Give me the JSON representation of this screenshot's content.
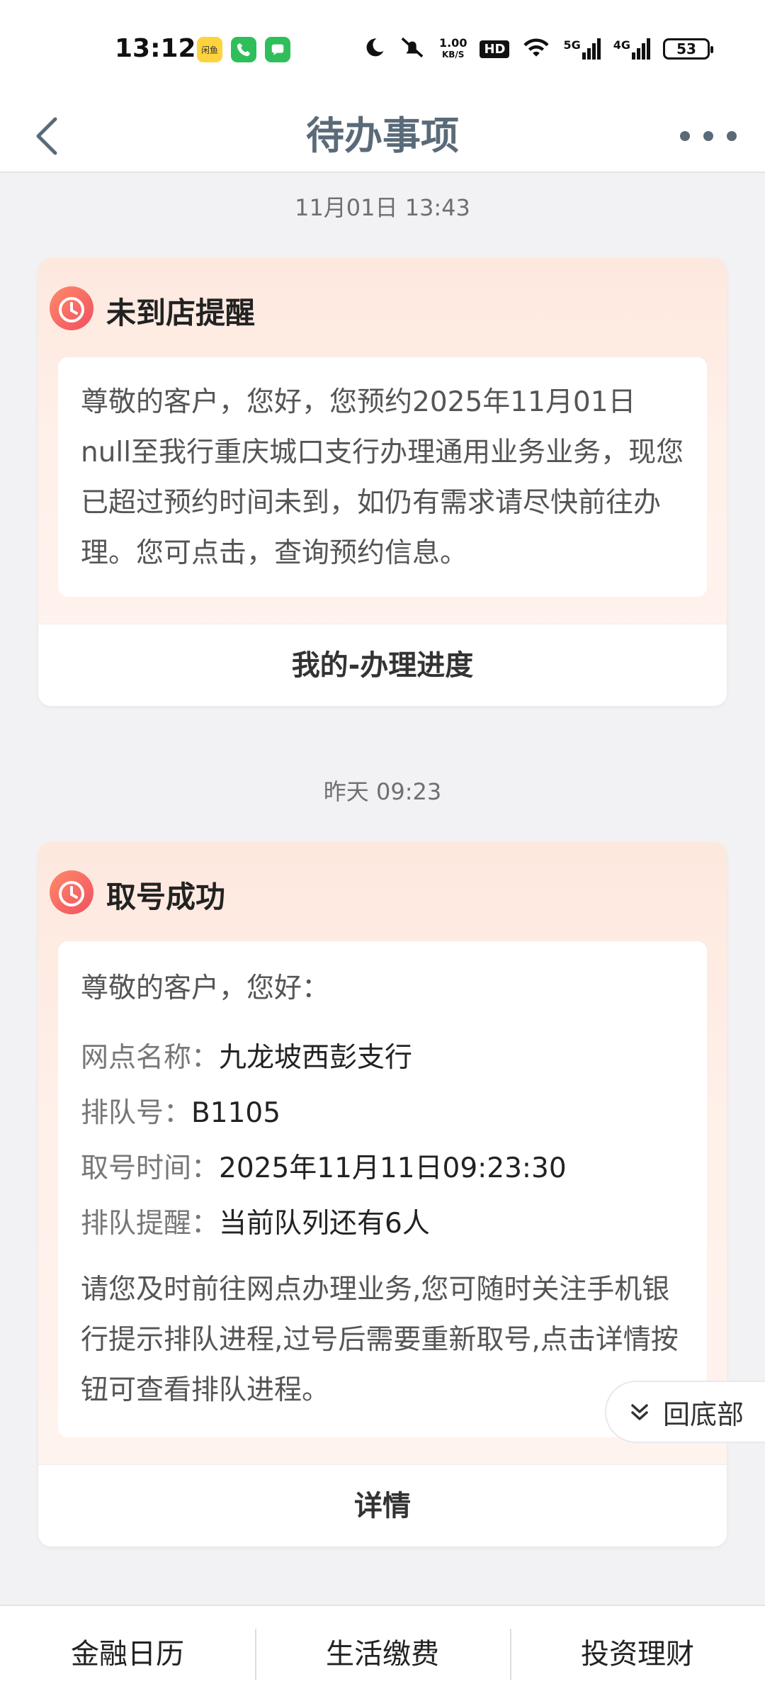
{
  "status_bar": {
    "time": "13:12",
    "network_speed_value": "1.00",
    "network_speed_unit": "KB/S",
    "hd_label": "HD",
    "signal1_label": "5G",
    "signal2_label": "4G",
    "battery_level": "53",
    "app_badge_label": "闲鱼"
  },
  "header": {
    "title": "待办事项"
  },
  "messages": [
    {
      "timestamp": "11月01日 13:43",
      "title": "未到店提醒",
      "body": "尊敬的客户，您好，您预约2025年11月01日null至我行重庆城口支行办理通用业务业务，现您已超过预约时间未到，如仍有需求请尽快前往办理。您可点击，查询预约信息。",
      "action_label": "我的-办理进度"
    },
    {
      "timestamp": "昨天 09:23",
      "title": "取号成功",
      "greeting": "尊敬的客户，您好：",
      "fields": [
        {
          "label": "网点名称：",
          "value": "九龙坡西彭支行"
        },
        {
          "label": "排队号：",
          "value": "B1105"
        },
        {
          "label": "取号时间：",
          "value": "2025年11月11日09:23:30"
        },
        {
          "label": "排队提醒：",
          "value": "当前队列还有6人"
        }
      ],
      "note": "请您及时前往网点办理业务,您可随时关注手机银行提示排队进程,过号后需要重新取号,点击详情按钮可查看排队进程。",
      "action_label": "详情"
    }
  ],
  "float_button": {
    "label": "回底部"
  },
  "bottom_nav": {
    "items": [
      {
        "label": "金融日历"
      },
      {
        "label": "生活缴费"
      },
      {
        "label": "投资理财"
      }
    ]
  },
  "colors": {
    "title_gray": "#5a6a78",
    "icon_red": "#f0505f",
    "card_bg": "#fde8de"
  }
}
